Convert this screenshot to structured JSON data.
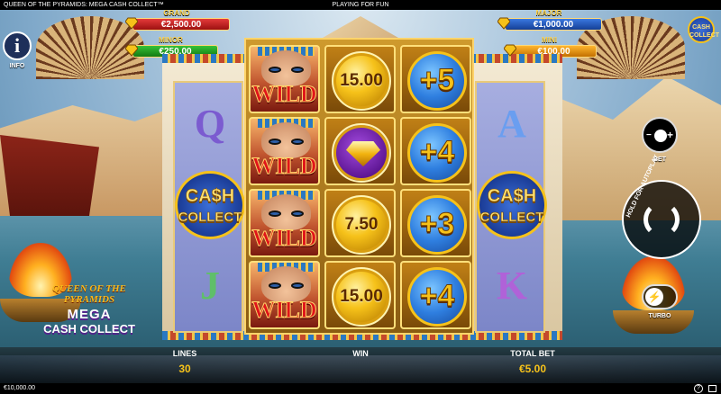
{
  "header": {
    "game_title": "QUEEN OF THE PYRAMIDS: MEGA CASH COLLECT™",
    "mode": "PLAYING FOR FUN"
  },
  "jackpots": {
    "grand": {
      "label": "GRAND",
      "value": "€2,500.00"
    },
    "minor": {
      "label": "MINOR",
      "value": "€250.00"
    },
    "major": {
      "label": "MAJOR",
      "value": "€1,000.00"
    },
    "mini": {
      "label": "MINI",
      "value": "€100.00"
    }
  },
  "controls": {
    "info": {
      "icon": "info-icon",
      "label": "INFO"
    },
    "bet": {
      "icon": "coin-stack-icon",
      "label": "BET"
    },
    "autoplay": {
      "icon": "spin-arrows-icon",
      "label": "HOLD FOR AUTOPLAY"
    },
    "turbo": {
      "icon": "lightning-icon",
      "label": "TURBO"
    },
    "cash_collect_badge": {
      "line1": "CASH",
      "line2": "COLLECT"
    }
  },
  "reels": {
    "left": [
      {
        "symbol": "Q",
        "kind": "letter"
      },
      {
        "symbol": "CASH COLLECT",
        "kind": "cash-collect",
        "line1": "CA$H",
        "line2": "COLLECT"
      },
      {
        "symbol": "J",
        "kind": "letter"
      }
    ],
    "wild_reel": [
      {
        "label": "WILD"
      },
      {
        "label": "WILD"
      },
      {
        "label": "WILD"
      },
      {
        "label": "WILD"
      }
    ],
    "coin_reel": [
      {
        "kind": "coin",
        "value": "15.00"
      },
      {
        "kind": "gem",
        "icon": "diamond-icon"
      },
      {
        "kind": "coin",
        "value": "7.50"
      },
      {
        "kind": "coin",
        "value": "15.00"
      }
    ],
    "plus_reel": [
      {
        "value": "+5"
      },
      {
        "value": "+4"
      },
      {
        "value": "+3"
      },
      {
        "value": "+4"
      }
    ],
    "right": [
      {
        "symbol": "A",
        "kind": "letter"
      },
      {
        "symbol": "CASH COLLECT",
        "kind": "cash-collect",
        "line1": "CA$H",
        "line2": "COLLECT"
      },
      {
        "symbol": "K",
        "kind": "letter"
      }
    ]
  },
  "logo": {
    "line1": "QUEEN OF THE PYRAMIDS",
    "line2": "MEGA",
    "line3": "CASH COLLECT"
  },
  "bottom_bar": {
    "lines": {
      "label": "LINES",
      "value": "30"
    },
    "win": {
      "label": "WIN",
      "value": ""
    },
    "total_bet": {
      "label": "TOTAL BET",
      "value": "€5.00"
    }
  },
  "status": {
    "balance": "€10,000.00",
    "help_icon": "question-icon",
    "fullscreen_icon": "fullscreen-icon"
  },
  "colors": {
    "grand": "#c81e1e",
    "minor": "#20a020",
    "major": "#1e5ac8",
    "mini": "#f0a01e",
    "accent_gold": "#f6c21a"
  }
}
